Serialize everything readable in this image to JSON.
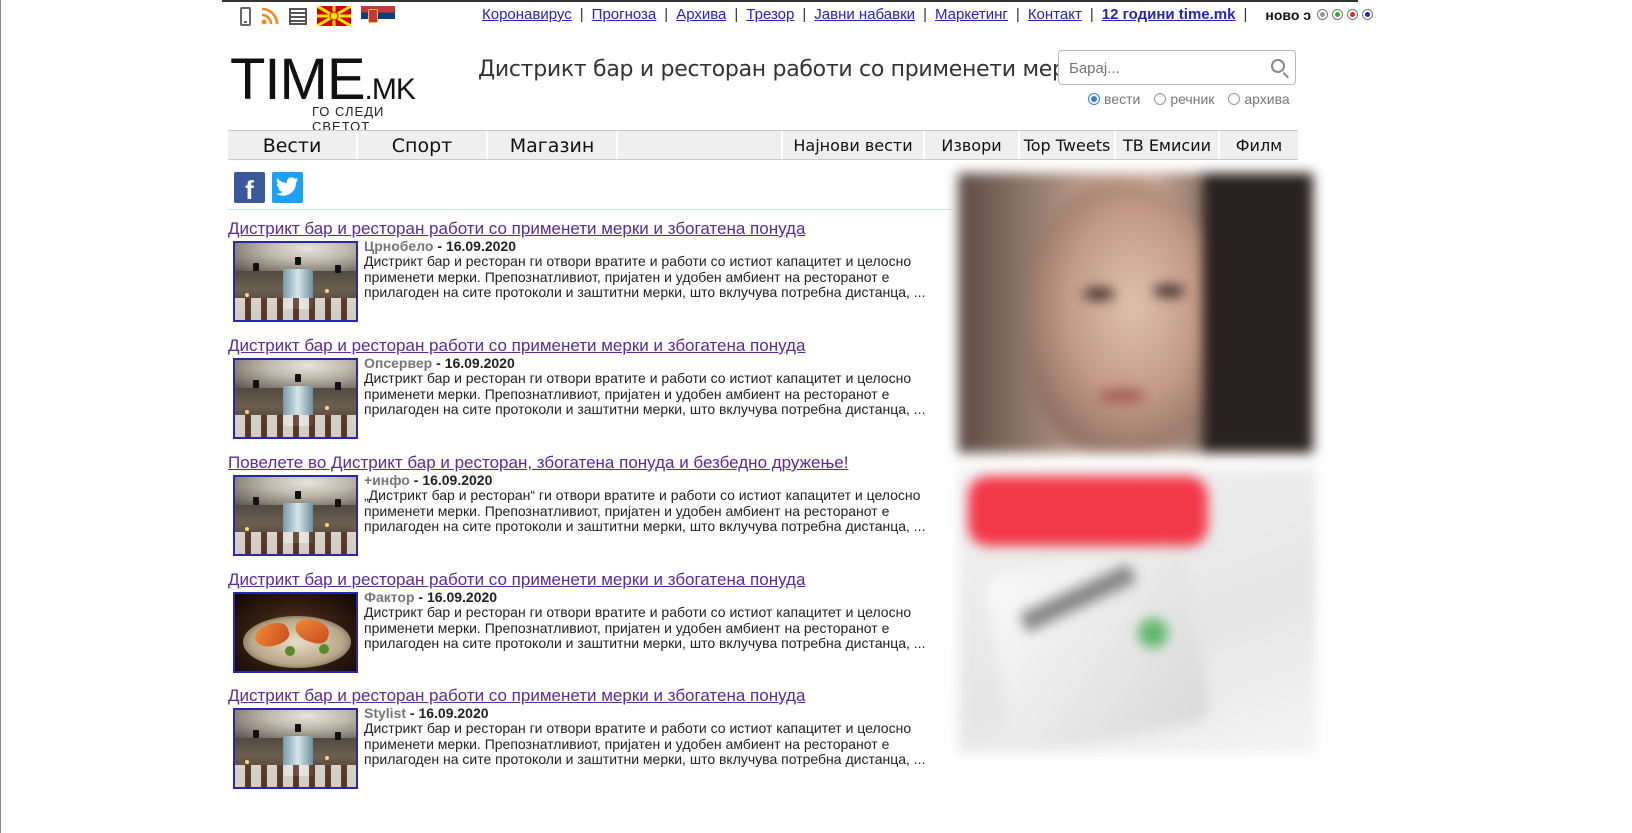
{
  "topbar": {
    "links": [
      "Коронавирус",
      "Прогноза",
      "Архива",
      "Трезор",
      "Јавни набавки",
      "Маркетинг",
      "Контакт"
    ],
    "anniversary": "12 години time.mk",
    "novo": "ново"
  },
  "logo": {
    "main": "TIME",
    "suffix": ".MK",
    "tagline": "ГО СЛЕДИ СВЕТОТ"
  },
  "headline": "Дистрикт бар и ресторан работи со применети мерки и...",
  "search": {
    "placeholder": "Барај...",
    "options": [
      {
        "label": "вести",
        "selected": true
      },
      {
        "label": "речник",
        "selected": false
      },
      {
        "label": "архива",
        "selected": false
      }
    ]
  },
  "nav": {
    "main": [
      "Вести",
      "Спорт",
      "Магазин"
    ],
    "secondary": [
      "Најнови вести",
      "Извори",
      "Top Tweets",
      "ТВ Емисии",
      "Филм"
    ]
  },
  "social": {
    "facebook": "f"
  },
  "articles": [
    {
      "title": "Дистрикт бар и ресторан работи со применети мерки и збогатена понуда",
      "source": "Црнобело",
      "date": "16.09.2020",
      "text": "Дистрикт бар и ресторан ги отвори вратите и работи со истиот капацитет и целосно применети мерки. Препознатливиот, пријатен и удобен амбиент на ресторанот е прилагоден на сите протоколи и заштитни мерки, што вклучува потребна дистанца, ...",
      "thumb": "restaurant"
    },
    {
      "title": "Дистрикт бар и ресторан работи со применети мерки и збогатена понуда",
      "source": "Опсервер",
      "date": "16.09.2020",
      "text": "Дистрикт бар и ресторан ги отвори вратите и работи со истиот капацитет и целосно применети мерки. Препознатливиот, пријатен и удобен амбиент на ресторанот е прилагоден на сите протоколи и заштитни мерки, што вклучува потребна дистанца, ...",
      "thumb": "restaurant"
    },
    {
      "title": "Повелете во Дистрикт бар и ресторан, збогатена понуда и безбедно дружење!",
      "source": "+инфо",
      "date": "16.09.2020",
      "text": "„Дистрикт бар и ресторан“ ги отвори вратите и работи со истиот капацитет и целосно применети мерки. Препознатливиот, пријатен и удобен амбиент на ресторанот е прилагоден на сите протоколи и заштитни мерки, што вклучува потребна дистанца, ...",
      "thumb": "restaurant"
    },
    {
      "title": "Дистрикт бар и ресторан работи со применети мерки и збогатена понуда",
      "source": "Фактор",
      "date": "16.09.2020",
      "text": "Дистрикт бар и ресторан ги отвори вратите и работи со истиот капацитет и целосно применети мерки. Препознатливиот, пријатен и удобен амбиент на ресторанот е прилагоден на сите протоколи и заштитни мерки, што вклучува потребна дистанца, ...",
      "thumb": "food"
    },
    {
      "title": "Дистрикт бар и ресторан работи со применети мерки и збогатена понуда",
      "source": "Stylist",
      "date": "16.09.2020",
      "text": "Дистрикт бар и ресторан ги отвори вратите и работи со истиот капацитет и целосно применети мерки. Препознатливиот, пријатен и удобен амбиент на ресторанот е прилагоден на сите протоколи и заштитни мерки, што вклучува потребна дистанца, ...",
      "thumb": "restaurant"
    }
  ],
  "colors": {
    "link": "#2424b8",
    "visited": "#5a2a9a",
    "facebook": "#3b5998",
    "twitter": "#1da1f2"
  }
}
